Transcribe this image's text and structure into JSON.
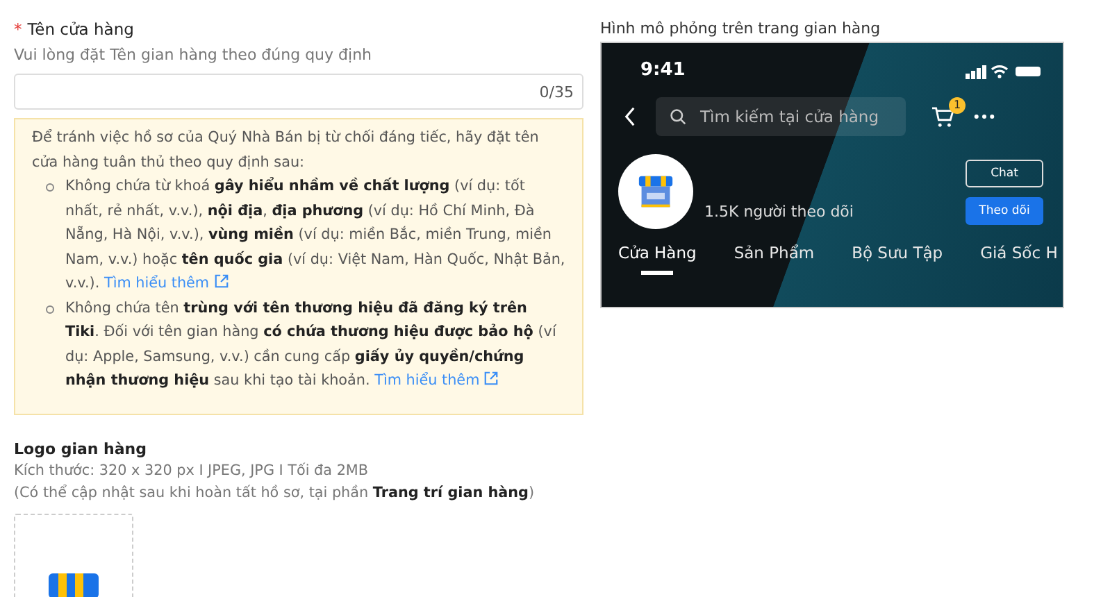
{
  "store_name": {
    "required_mark": "*",
    "label": "Tên cửa hàng",
    "hint": "Vui lòng đặt Tên gian hàng theo đúng quy định",
    "counter": "0/35"
  },
  "notice": {
    "intro": "Để tránh việc hồ sơ của Quý Nhà Bán bị từ chối đáng tiếc, hãy đặt tên cửa hàng tuân thủ theo quy định sau:",
    "rules": [
      {
        "text": "Không chứa từ khoá **gây hiểu nhầm về chất lượng** (ví dụ: tốt nhất, rẻ nhất, v.v.), **nội địa**, **địa phương** (ví dụ: Hồ Chí Minh, Đà Nẵng, Hà Nội, v.v.), **vùng miền** (ví dụ: miền Bắc, miền Trung, miền Nam, v.v.) hoặc **tên quốc gia** (ví dụ: Việt Nam, Hàn Quốc, Nhật Bản, v.v.).",
        "link": "Tìm hiểu thêm"
      },
      {
        "text": "Không chứa tên **trùng với tên thương hiệu đã đăng ký trên Tiki**. Đối với tên gian hàng **có chứa thương hiệu được bảo hộ** (ví dụ: Apple, Samsung, v.v.) cần cung cấp **giấy ủy quyền/chứng nhận thương hiệu** sau khi tạo tài khoản.",
        "link": "Tìm hiểu thêm"
      }
    ]
  },
  "logo": {
    "label": "Logo gian hàng",
    "size_info": "Kích thước: 320 x 320 px I JPEG, JPG I Tối đa 2MB",
    "note": "(Có thể cập nhật sau khi hoàn tất hồ sơ, tại phần **Trang trí gian hàng**)"
  },
  "preview": {
    "label": "Hình mô phỏng trên trang gian hàng",
    "time": "9:41",
    "search_placeholder": "Tìm kiếm tại cửa hàng",
    "cart_badge": "1",
    "followers": "1.5K người theo dõi",
    "chat_button": "Chat",
    "follow_button": "Theo dõi",
    "tabs": [
      {
        "label": "Cửa Hàng",
        "selected": true
      },
      {
        "label": "Sản Phẩm",
        "selected": false
      },
      {
        "label": "Bộ Sưu Tập",
        "selected": false
      },
      {
        "label": "Giá Sốc H",
        "selected": false
      }
    ]
  }
}
